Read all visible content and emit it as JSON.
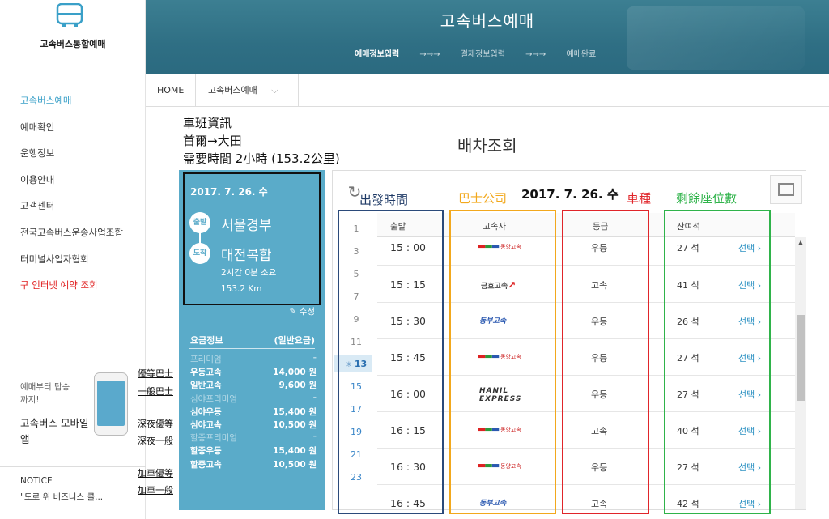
{
  "sidebar": {
    "logo_text": "고속버스통합예매",
    "menu": [
      {
        "label": "고속버스예매"
      },
      {
        "label": "예매확인"
      },
      {
        "label": "운행정보"
      },
      {
        "label": "이용안내"
      },
      {
        "label": "고객센터"
      },
      {
        "label": "전국고속버스운송사업조합"
      },
      {
        "label": "터미널사업자협회"
      },
      {
        "label": "구 인터넷 예약 조회"
      }
    ],
    "mobile_small": "예매부터 탑승까지!",
    "mobile_big": "고속버스 모바일앱",
    "notice_title": "NOTICE",
    "notice_text": "\"도로 위 비즈니스 클..."
  },
  "header": {
    "title": "고속버스예매",
    "steps": [
      "예매정보입력",
      "→→→",
      "결제정보입력",
      "→→→",
      "예매완료"
    ]
  },
  "breadcrumb": {
    "home": "HOME",
    "current": "고속버스예매",
    "chevron": "⌵"
  },
  "annotation_info": {
    "line1": "車班資訊",
    "line2": "首爾→大田",
    "line3": "需要時間 2小時 (153.2公里)"
  },
  "page_title": "배차조회",
  "trip": {
    "date": "2017. 7. 26. 수",
    "depart_badge": "출발",
    "depart": "서울경부",
    "arrive_badge": "도착",
    "arrive": "대전복합",
    "duration": "2시간 0분 소요",
    "distance": "153.2 Km",
    "edit": "✎ 수정"
  },
  "fares": {
    "title": "요금정보",
    "subtitle": "(일반요금)",
    "rows": [
      {
        "type": "cat",
        "name": "프리미엄",
        "amount": "-"
      },
      {
        "type": "item",
        "name": "우등고속",
        "amount": "14,000 원"
      },
      {
        "type": "item",
        "name": "일반고속",
        "amount": "9,600 원"
      },
      {
        "type": "cat",
        "name": "심야프리미엄",
        "amount": "-"
      },
      {
        "type": "item",
        "name": "심야우등",
        "amount": "15,400 원"
      },
      {
        "type": "item",
        "name": "심야고속",
        "amount": "10,500 원"
      },
      {
        "type": "cat",
        "name": "할증프리미엄",
        "amount": "-"
      },
      {
        "type": "item",
        "name": "할증우등",
        "amount": "15,400 원"
      },
      {
        "type": "item",
        "name": "할증고속",
        "amount": "10,500 원"
      }
    ]
  },
  "fare_annotations": [
    "優等巴士",
    "一般巴士",
    "深夜優等",
    "深夜一般",
    "加車優等",
    "加車一般"
  ],
  "timetable": {
    "date": "2017. 7. 26. 수",
    "refresh_icon": "↻",
    "hours": [
      "1",
      "3",
      "5",
      "7",
      "9",
      "11",
      "13",
      "15",
      "17",
      "19",
      "21",
      "23"
    ],
    "selected_hour": "13",
    "selected_prefix": "☼",
    "headers": {
      "time": "출발",
      "company": "고속사",
      "grade": "등급",
      "seats": "잔여석"
    },
    "rows": [
      {
        "time": "15 : 00",
        "company": "동양고속",
        "grade": "우등",
        "seats": "27 석",
        "select": "선택 ›"
      },
      {
        "time": "15 : 15",
        "company": "금호고속",
        "grade": "고속",
        "seats": "41 석",
        "select": "선택 ›"
      },
      {
        "time": "15 : 30",
        "company": "동부고속",
        "grade": "우등",
        "seats": "26 석",
        "select": "선택 ›"
      },
      {
        "time": "15 : 45",
        "company": "동양고속",
        "grade": "우등",
        "seats": "27 석",
        "select": "선택 ›"
      },
      {
        "time": "16 : 00",
        "company": "HANIL EXPRESS",
        "grade": "우등",
        "seats": "27 석",
        "select": "선택 ›"
      },
      {
        "time": "16 : 15",
        "company": "동양고속",
        "grade": "고속",
        "seats": "40 석",
        "select": "선택 ›"
      },
      {
        "time": "16 : 30",
        "company": "동양고속",
        "grade": "우등",
        "seats": "27 석",
        "select": "선택 ›"
      },
      {
        "time": "16 : 45",
        "company": "동부고속",
        "grade": "고속",
        "seats": "42 석",
        "select": "선택 ›"
      }
    ]
  },
  "annotations": {
    "departure_time": "出發時間",
    "bus_company": "巴士公司",
    "bus_type": "車種",
    "seats_left": "剩餘座位數"
  },
  "colors": {
    "accent": "#5aabc9",
    "link": "#2e92c3",
    "navy_box": "#2b4a7a",
    "orange_box": "#f2a81d",
    "red_box": "#e0252a",
    "green_box": "#2fb34a"
  }
}
